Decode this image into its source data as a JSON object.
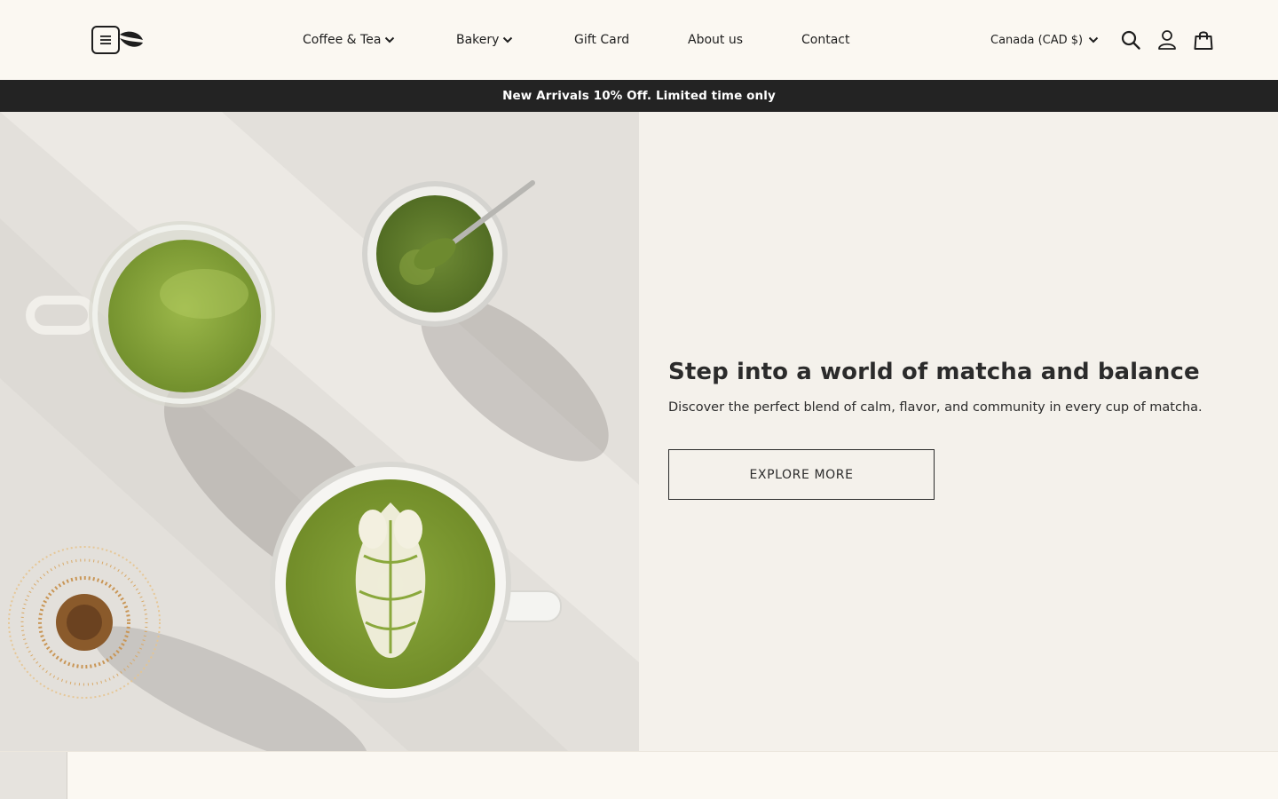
{
  "header": {
    "logo_alt": "Coffee bean logo",
    "nav": [
      {
        "label": "Coffee & Tea",
        "has_dropdown": true
      },
      {
        "label": "Bakery",
        "has_dropdown": true
      },
      {
        "label": "Gift Card",
        "has_dropdown": false
      },
      {
        "label": "About us",
        "has_dropdown": false
      },
      {
        "label": "Contact",
        "has_dropdown": false
      }
    ],
    "currency": "Canada (CAD $)",
    "icons": [
      "search-icon",
      "account-icon",
      "cart-icon"
    ]
  },
  "announcement": {
    "text": "New Arrivals 10% Off. Limited time only"
  },
  "hero": {
    "title": "Step into a world of matcha and balance",
    "subtitle": "Discover the perfect blend of calm, flavor, and community in every cup of matcha.",
    "button_label": "EXPLORE MORE",
    "image_description": "Top-down photo of matcha drinks: glass mug of matcha, bowl of matcha powder with spoon, matcha latte with leaf art, bamboo whisk"
  },
  "colors": {
    "background": "#fbf8f2",
    "hero_panel": "#f4f1eb",
    "announcement_bg": "#232323",
    "text": "#1e1e1e",
    "matcha_green": "#7b9a36"
  }
}
